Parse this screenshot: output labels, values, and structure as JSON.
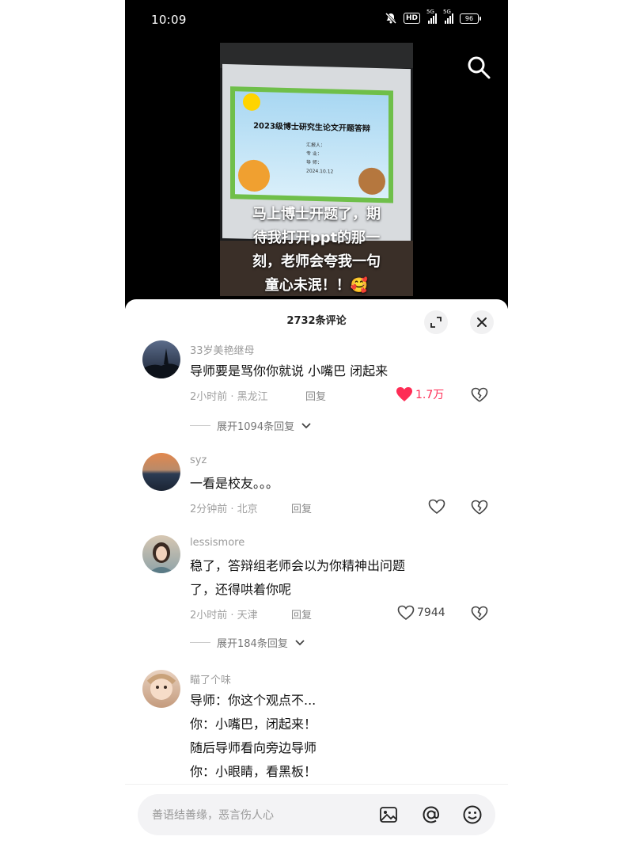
{
  "status": {
    "time": "10:09",
    "hd": "HD",
    "net1": "5G",
    "net2": "5G",
    "battery": "96"
  },
  "video": {
    "slide_title": "2023级博士研究生论文开题答辩",
    "slide_fields": [
      "汇报人：",
      "专    业：",
      "导    师：",
      "2024.10.12"
    ],
    "caption_lines": [
      "马上博士开题了，期",
      "待我打开ppt的那一",
      "刻，老师会夸我一句",
      "童心未泯！！🥰"
    ]
  },
  "sheet": {
    "title": "2732条评论",
    "comments": [
      {
        "user": "33岁美艳继母",
        "lines": [
          "导师要是骂你你就说 小嘴巴 闭起来"
        ],
        "meta": "2小时前 · 黑龙江",
        "reply": "回复",
        "likes": "1.7万",
        "liked": true,
        "expand": "展开1094条回复"
      },
      {
        "user": "syz",
        "lines": [
          "一看是校友。。。"
        ],
        "meta": "2分钟前 · 北京",
        "reply": "回复",
        "likes": "",
        "liked": false,
        "expand": ""
      },
      {
        "user": "lessismore",
        "lines": [
          "稳了，答辩组老师会以为你精神出问题",
          "了，还得哄着你呢"
        ],
        "meta": "2小时前 · 天津",
        "reply": "回复",
        "likes": "7944",
        "liked": false,
        "expand": "展开184条回复"
      },
      {
        "user": "瞄了个味",
        "lines": [
          "导师：你这个观点不...",
          "你：小嘴巴，闭起来！",
          "随后导师看向旁边导师",
          "你：小眼睛，看黑板！"
        ],
        "meta": "",
        "reply": "",
        "likes": "",
        "liked": false,
        "expand": ""
      }
    ]
  },
  "input": {
    "placeholder": "善语结善缘，恶言伤人心"
  },
  "colors": {
    "like_red": "#fe2c55",
    "text": "#111111",
    "muted": "#9a9a9a"
  }
}
